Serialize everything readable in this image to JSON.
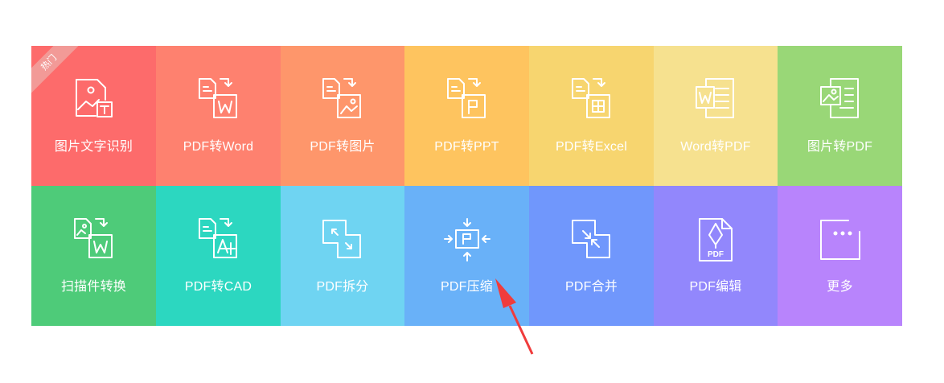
{
  "hot_badge": "热门",
  "tiles": [
    {
      "label": "图片文字识别",
      "icon": "image-text-ocr-icon",
      "color": "#fd6b6b"
    },
    {
      "label": "PDF转Word",
      "icon": "pdf-to-word-icon",
      "color": "#fe816f"
    },
    {
      "label": "PDF转图片",
      "icon": "pdf-to-image-icon",
      "color": "#fe966b"
    },
    {
      "label": "PDF转PPT",
      "icon": "pdf-to-ppt-icon",
      "color": "#fec45f"
    },
    {
      "label": "PDF转Excel",
      "icon": "pdf-to-excel-icon",
      "color": "#f7d56f"
    },
    {
      "label": "Word转PDF",
      "icon": "word-to-pdf-icon",
      "color": "#f6e18f"
    },
    {
      "label": "图片转PDF",
      "icon": "image-to-pdf-icon",
      "color": "#99d777"
    },
    {
      "label": "扫描件转换",
      "icon": "scan-convert-icon",
      "color": "#4ecb79"
    },
    {
      "label": "PDF转CAD",
      "icon": "pdf-to-cad-icon",
      "color": "#2cd7c0"
    },
    {
      "label": "PDF拆分",
      "icon": "pdf-split-icon",
      "color": "#6fd4f2"
    },
    {
      "label": "PDF压缩",
      "icon": "pdf-compress-icon",
      "color": "#69b1f8"
    },
    {
      "label": "PDF合并",
      "icon": "pdf-merge-icon",
      "color": "#7097fc"
    },
    {
      "label": "PDF编辑",
      "icon": "pdf-edit-icon",
      "color": "#9287fc"
    },
    {
      "label": "更多",
      "icon": "more-icon",
      "color": "#b884fc"
    }
  ],
  "pointer_target": "PDF压缩",
  "pointer_color": "#f03c3c"
}
